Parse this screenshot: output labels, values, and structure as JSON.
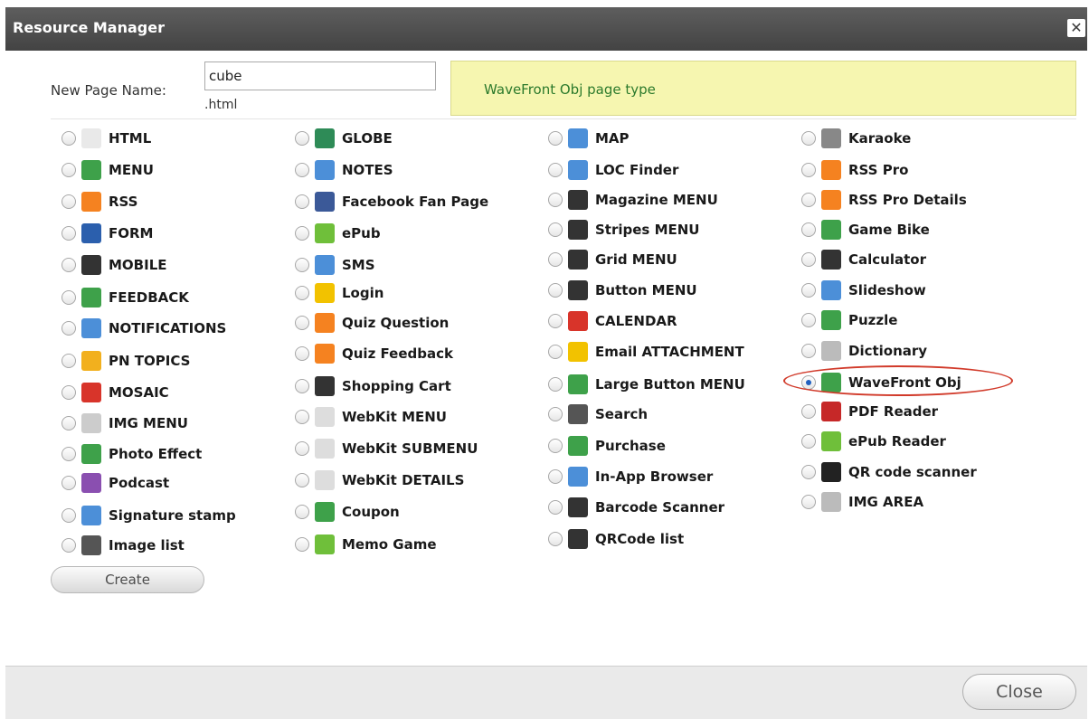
{
  "window": {
    "title": "Resource Manager",
    "close_glyph": "✕"
  },
  "form": {
    "new_page_label": "New Page Name:",
    "page_name_value": "cube",
    "extension": ".html",
    "page_type_info": "WaveFront Obj page type"
  },
  "columns": [
    [
      {
        "label": "HTML",
        "icon": "html-page-icon",
        "color": "#e9e9e9"
      },
      {
        "label": "MENU",
        "icon": "menu-icon",
        "color": "#3ea14a"
      },
      {
        "label": "RSS",
        "icon": "rss-icon",
        "color": "#f58220"
      },
      {
        "label": "FORM",
        "icon": "pencil-icon",
        "color": "#2b5fad"
      },
      {
        "label": "MOBILE",
        "icon": "mobile-phone-icon",
        "color": "#333333"
      },
      {
        "label": "FEEDBACK",
        "icon": "feedback-icon",
        "color": "#3ea14a"
      },
      {
        "label": "NOTIFICATIONS",
        "icon": "notifications-icon",
        "color": "#4c8fd8"
      },
      {
        "label": "PN TOPICS",
        "icon": "pn-topics-icon",
        "color": "#f2b01e"
      },
      {
        "label": "MOSAIC",
        "icon": "mosaic-icon",
        "color": "#d8342a"
      },
      {
        "label": "IMG MENU",
        "icon": "img-menu-icon",
        "color": "#cccccc"
      },
      {
        "label": "Photo Effect",
        "icon": "camera-icon",
        "color": "#3ea14a"
      },
      {
        "label": "Podcast",
        "icon": "podcast-icon",
        "color": "#8a4fb0"
      },
      {
        "label": "Signature stamp",
        "icon": "signature-icon",
        "color": "#4c8fd8"
      },
      {
        "label": "Image list",
        "icon": "image-list-icon",
        "color": "#555555"
      }
    ],
    [
      {
        "label": "GLOBE",
        "icon": "globe-icon",
        "color": "#2e8b57"
      },
      {
        "label": "NOTES",
        "icon": "notes-icon",
        "color": "#4c8fd8"
      },
      {
        "label": "Facebook Fan Page",
        "icon": "facebook-icon",
        "color": "#3b5998"
      },
      {
        "label": "ePub",
        "icon": "epub-icon",
        "color": "#6fbf3a"
      },
      {
        "label": "SMS",
        "icon": "envelope-icon",
        "color": "#4c8fd8"
      },
      {
        "label": "Login",
        "icon": "padlock-icon",
        "color": "#f2c200"
      },
      {
        "label": "Quiz Question",
        "icon": "quiz-question-icon",
        "color": "#f58220"
      },
      {
        "label": "Quiz Feedback",
        "icon": "quiz-feedback-icon",
        "color": "#f58220"
      },
      {
        "label": "Shopping Cart",
        "icon": "shopping-cart-icon",
        "color": "#333333"
      },
      {
        "label": "WebKit MENU",
        "icon": "webkit-menu-icon",
        "color": "#dddddd"
      },
      {
        "label": "WebKit SUBMENU",
        "icon": "webkit-submenu-icon",
        "color": "#dddddd"
      },
      {
        "label": "WebKit DETAILS",
        "icon": "webkit-details-icon",
        "color": "#dddddd"
      },
      {
        "label": "Coupon",
        "icon": "scissors-icon",
        "color": "#3ea14a"
      },
      {
        "label": "Memo Game",
        "icon": "memo-game-icon",
        "color": "#6fbf3a"
      }
    ],
    [
      {
        "label": "MAP",
        "icon": "map-icon",
        "color": "#4c8fd8"
      },
      {
        "label": "LOC Finder",
        "icon": "locator-icon",
        "color": "#4c8fd8"
      },
      {
        "label": "Magazine MENU",
        "icon": "magazine-menu-icon",
        "color": "#333333"
      },
      {
        "label": "Stripes MENU",
        "icon": "stripes-menu-icon",
        "color": "#333333"
      },
      {
        "label": "Grid MENU",
        "icon": "grid-menu-icon",
        "color": "#333333"
      },
      {
        "label": "Button MENU",
        "icon": "button-menu-icon",
        "color": "#333333"
      },
      {
        "label": "CALENDAR",
        "icon": "calendar-icon",
        "color": "#d8342a"
      },
      {
        "label": "Email ATTACHMENT",
        "icon": "email-attachment-icon",
        "color": "#f2c200"
      },
      {
        "label": "Large Button MENU",
        "icon": "large-button-menu-icon",
        "color": "#3ea14a"
      },
      {
        "label": "Search",
        "icon": "search-icon",
        "color": "#555555"
      },
      {
        "label": "Purchase",
        "icon": "purchase-icon",
        "color": "#3ea14a"
      },
      {
        "label": "In-App Browser",
        "icon": "browser-icon",
        "color": "#4c8fd8"
      },
      {
        "label": "Barcode Scanner",
        "icon": "barcode-icon",
        "color": "#333333"
      },
      {
        "label": "QRCode list",
        "icon": "qrcode-icon",
        "color": "#333333"
      }
    ],
    [
      {
        "label": "Karaoke",
        "icon": "microphone-icon",
        "color": "#888888"
      },
      {
        "label": "RSS Pro",
        "icon": "rss-pro-icon",
        "color": "#f58220"
      },
      {
        "label": "RSS Pro Details",
        "icon": "rss-pro-details-icon",
        "color": "#f58220"
      },
      {
        "label": "Game Bike",
        "icon": "bike-icon",
        "color": "#3ea14a"
      },
      {
        "label": "Calculator",
        "icon": "sigma-icon",
        "color": "#333333"
      },
      {
        "label": "Slideshow",
        "icon": "slideshow-icon",
        "color": "#4c8fd8"
      },
      {
        "label": "Puzzle",
        "icon": "puzzle-icon",
        "color": "#3ea14a"
      },
      {
        "label": "Dictionary",
        "icon": "dictionary-icon",
        "color": "#bbbbbb"
      },
      {
        "label": "WaveFront Obj",
        "icon": "wavefront-obj-icon",
        "color": "#3ea14a",
        "selected": true
      },
      {
        "label": "PDF Reader",
        "icon": "pdf-icon",
        "color": "#c62828"
      },
      {
        "label": "ePub Reader",
        "icon": "epub-reader-icon",
        "color": "#6fbf3a"
      },
      {
        "label": "QR code scanner",
        "icon": "qr-scanner-icon",
        "color": "#222222"
      },
      {
        "label": "IMG AREA",
        "icon": "img-area-icon",
        "color": "#bbbbbb"
      }
    ]
  ],
  "buttons": {
    "create": "Create",
    "close": "Close"
  }
}
